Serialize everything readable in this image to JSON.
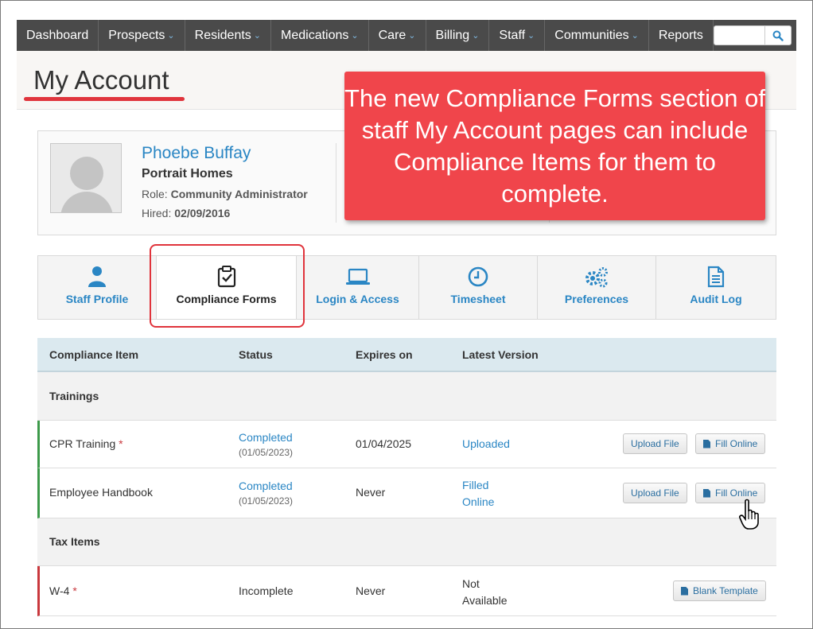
{
  "nav": {
    "items": [
      {
        "label": "Dashboard",
        "dropdown": false
      },
      {
        "label": "Prospects",
        "dropdown": true
      },
      {
        "label": "Residents",
        "dropdown": true
      },
      {
        "label": "Medications",
        "dropdown": true
      },
      {
        "label": "Care",
        "dropdown": true
      },
      {
        "label": "Billing",
        "dropdown": true
      },
      {
        "label": "Staff",
        "dropdown": true
      },
      {
        "label": "Communities",
        "dropdown": true
      },
      {
        "label": "Reports",
        "dropdown": false
      }
    ],
    "search_icon": "search-icon"
  },
  "page": {
    "title": "My Account"
  },
  "profile": {
    "name": "Phoebe Buffay",
    "company": "Portrait Homes",
    "role_label": "Role:",
    "role_value": "Community Administrator",
    "hired_label": "Hired:",
    "hired_value": "02/09/2016"
  },
  "callout": {
    "text": "The new Compliance Forms section of staff My Account pages can include Compliance Items for them to complete."
  },
  "tabs": [
    {
      "label": "Staff Profile",
      "icon": "person-icon"
    },
    {
      "label": "Compliance Forms",
      "icon": "clipboard-check-icon",
      "active": true
    },
    {
      "label": "Login & Access",
      "icon": "laptop-icon"
    },
    {
      "label": "Timesheet",
      "icon": "clock-icon"
    },
    {
      "label": "Preferences",
      "icon": "gears-icon"
    },
    {
      "label": "Audit Log",
      "icon": "document-icon"
    }
  ],
  "table": {
    "headers": [
      "Compliance Item",
      "Status",
      "Expires on",
      "Latest Version"
    ],
    "sections": [
      {
        "title": "Trainings",
        "rows": [
          {
            "item": "CPR Training",
            "required": "*",
            "status": "Completed",
            "status_date": "(01/05/2023)",
            "expires": "01/04/2025",
            "version": "Uploaded",
            "buttons": [
              "Upload File",
              "Fill Online"
            ]
          },
          {
            "item": "Employee Handbook",
            "required": "",
            "status": "Completed",
            "status_date": "(01/05/2023)",
            "expires": "Never",
            "version": "Filled Online",
            "buttons": [
              "Upload File",
              "Fill Online"
            ]
          }
        ]
      },
      {
        "title": "Tax Items",
        "rows": [
          {
            "item": "W-4",
            "required": "*",
            "status": "Incomplete",
            "status_date": "",
            "expires": "Never",
            "version": "Not Available",
            "buttons": [
              "Blank Template"
            ]
          }
        ]
      }
    ]
  },
  "colors": {
    "nav_bg": "#4a4a4a",
    "link": "#2a86c4",
    "callout": "#f0454b",
    "highlight": "#e0343c",
    "complete_border": "#3d9a4a",
    "incomplete_border": "#c9383d"
  }
}
